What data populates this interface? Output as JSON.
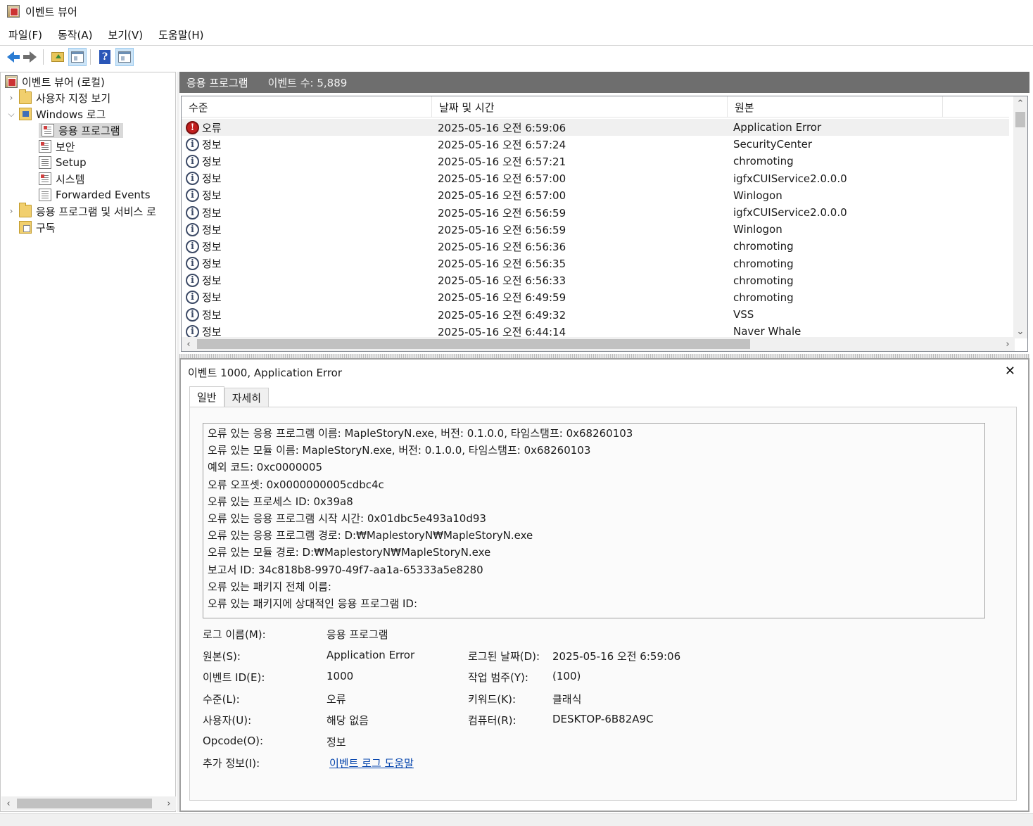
{
  "window": {
    "title": "이벤트 뷰어"
  },
  "menu": [
    "파일(F)",
    "동작(A)",
    "보기(V)",
    "도움말(H)"
  ],
  "tree": {
    "root": "이벤트 뷰어 (로컬)",
    "custom_views": "사용자 지정 보기",
    "windows_logs": "Windows 로그",
    "logs": [
      "응용 프로그램",
      "보안",
      "Setup",
      "시스템",
      "Forwarded Events"
    ],
    "app_services": "응용 프로그램 및 서비스 로",
    "subscriptions": "구독"
  },
  "header": {
    "title": "응용 프로그램",
    "count": "이벤트 수: 5,889"
  },
  "columns": [
    "수준",
    "날짜 및 시간",
    "원본"
  ],
  "events": [
    {
      "level": "오류",
      "type": "error",
      "datetime": "2025-05-16 오전 6:59:06",
      "source": "Application Error"
    },
    {
      "level": "정보",
      "type": "info",
      "datetime": "2025-05-16 오전 6:57:24",
      "source": "SecurityCenter"
    },
    {
      "level": "정보",
      "type": "info",
      "datetime": "2025-05-16 오전 6:57:21",
      "source": "chromoting"
    },
    {
      "level": "정보",
      "type": "info",
      "datetime": "2025-05-16 오전 6:57:00",
      "source": "igfxCUIService2.0.0.0"
    },
    {
      "level": "정보",
      "type": "info",
      "datetime": "2025-05-16 오전 6:57:00",
      "source": "Winlogon"
    },
    {
      "level": "정보",
      "type": "info",
      "datetime": "2025-05-16 오전 6:56:59",
      "source": "igfxCUIService2.0.0.0"
    },
    {
      "level": "정보",
      "type": "info",
      "datetime": "2025-05-16 오전 6:56:59",
      "source": "Winlogon"
    },
    {
      "level": "정보",
      "type": "info",
      "datetime": "2025-05-16 오전 6:56:36",
      "source": "chromoting"
    },
    {
      "level": "정보",
      "type": "info",
      "datetime": "2025-05-16 오전 6:56:35",
      "source": "chromoting"
    },
    {
      "level": "정보",
      "type": "info",
      "datetime": "2025-05-16 오전 6:56:33",
      "source": "chromoting"
    },
    {
      "level": "정보",
      "type": "info",
      "datetime": "2025-05-16 오전 6:49:59",
      "source": "chromoting"
    },
    {
      "level": "정보",
      "type": "info",
      "datetime": "2025-05-16 오전 6:49:32",
      "source": "VSS"
    },
    {
      "level": "정보",
      "type": "info",
      "datetime": "2025-05-16 오전 6:44:14",
      "source": "Naver Whale"
    }
  ],
  "detail": {
    "title": "이벤트 1000, Application Error",
    "tabs": [
      "일반",
      "자세히"
    ],
    "message_lines": [
      "오류 있는 응용 프로그램 이름: MapleStoryN.exe, 버전: 0.1.0.0, 타임스탬프: 0x68260103",
      "오류 있는 모듈 이름: MapleStoryN.exe, 버전: 0.1.0.0, 타임스탬프: 0x68260103",
      "예외 코드: 0xc0000005",
      "오류 오프셋: 0x0000000005cdbc4c",
      "오류 있는 프로세스 ID: 0x39a8",
      "오류 있는 응용 프로그램 시작 시간: 0x01dbc5e493a10d93",
      "오류 있는 응용 프로그램 경로: D:₩MaplestoryN₩MapleStoryN.exe",
      "오류 있는 모듈 경로: D:₩MaplestoryN₩MapleStoryN.exe",
      "보고서 ID: 34c818b8-9970-49f7-aa1a-65333a5e8280",
      "오류 있는 패키지 전체 이름:",
      "오류 있는 패키지에 상대적인 응용 프로그램 ID:"
    ],
    "props": {
      "log_name_label": "로그 이름(M):",
      "log_name": "응용 프로그램",
      "source_label": "원본(S):",
      "source": "Application Error",
      "logged_label": "로그된 날짜(D):",
      "logged": "2025-05-16 오전 6:59:06",
      "event_id_label": "이벤트 ID(E):",
      "event_id": "1000",
      "category_label": "작업 범주(Y):",
      "category": "(100)",
      "level_label": "수준(L):",
      "level": "오류",
      "keywords_label": "키워드(K):",
      "keywords": "클래식",
      "user_label": "사용자(U):",
      "user": "해당 없음",
      "computer_label": "컴퓨터(R):",
      "computer": "DESKTOP-6B82A9C",
      "opcode_label": "Opcode(O):",
      "opcode": "정보",
      "more_info_label": "추가 정보(I):",
      "more_info_link": "이벤트 로그 도움말"
    }
  }
}
